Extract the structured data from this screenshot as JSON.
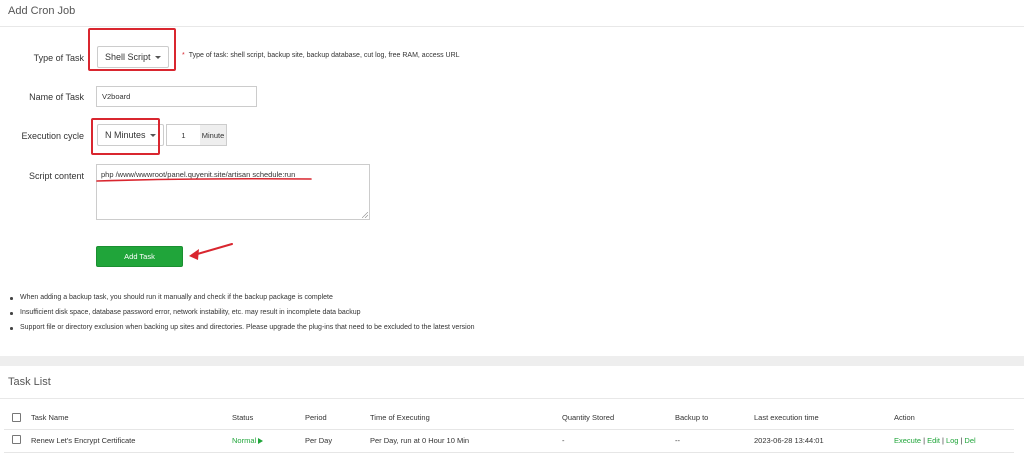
{
  "form": {
    "title": "Add Cron Job",
    "type_label": "Type of Task",
    "type_value": "Shell Script",
    "type_hint": "Type of task: shell script, backup site, backup database, cut log, free RAM, access URL",
    "hint_star": "*",
    "name_label": "Name of Task",
    "name_value": "V2board",
    "cycle_label": "Execution cycle",
    "cycle_value": "N Minutes",
    "cycle_number": "1",
    "cycle_unit": "Minute",
    "script_label": "Script content",
    "script_value": "php /www/wwwroot/panel.quyenit.site/artisan schedule:run",
    "add_button": "Add Task"
  },
  "notes": [
    "When adding a backup task, you should run it manually and check if the backup package is complete",
    "Insufficient disk space, database password error, network instability, etc. may result in incomplete data backup",
    "Support file or directory exclusion when backing up sites and directories. Please upgrade the plug-ins that need to be excluded to the latest version"
  ],
  "task_list": {
    "title": "Task List",
    "columns": [
      "Task Name",
      "Status",
      "Period",
      "Time of Executing",
      "Quantity Stored",
      "Backup to",
      "Last execution time",
      "Action"
    ],
    "rows": [
      {
        "name": "Renew Let's Encrypt Certificate",
        "status": "Normal",
        "period": "Per Day",
        "time": "Per Day, run at 0 Hour 10 Min",
        "quantity": "-",
        "backup": "--",
        "last": "2023-06-28 13:44:01",
        "actions": [
          "Execute",
          "Edit",
          "Log",
          "Del"
        ]
      }
    ]
  },
  "colors": {
    "accent_green": "#20a53a",
    "highlight_red": "#d9262f"
  },
  "icons": [
    "caret-down-icon",
    "play-icon",
    "checkbox-icon",
    "annotation-arrow-icon"
  ]
}
